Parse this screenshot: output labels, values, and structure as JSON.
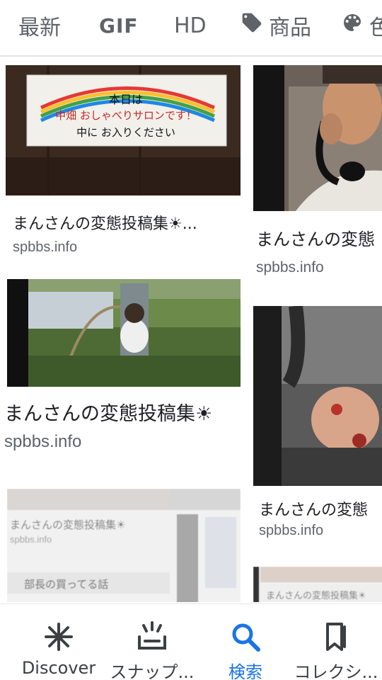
{
  "filters": [
    {
      "label": "最新"
    },
    {
      "label": "GIF"
    },
    {
      "label": "HD"
    },
    {
      "label": "商品",
      "icon": "tag-icon"
    },
    {
      "label": "色",
      "icon": "palette-icon"
    }
  ],
  "results": [
    {
      "caption": "まんさんの変態投稿集☀...",
      "domain": "spbbs.info",
      "sign_text": [
        "本日は",
        "中畑 おしゃべりサロンです！",
        "中に お入りください"
      ]
    },
    {
      "caption": "まんさんの変態",
      "domain": "spbbs.info"
    },
    {
      "caption": "まんさんの変態投稿集☀",
      "domain": "spbbs.info"
    },
    {
      "caption": "まんさんの変態",
      "domain": "spbbs.info"
    },
    {
      "caption": "まんさんの変態投稿集☀",
      "domain": "spbbs.info",
      "extra_text": "部長の買ってる話"
    },
    {
      "caption": "まんさんの変態投稿集☀"
    }
  ],
  "bottom_nav": [
    {
      "label": "Discover",
      "icon": "asterisk-icon",
      "active": false
    },
    {
      "label": "スナップ...",
      "icon": "snapshot-icon",
      "active": false
    },
    {
      "label": "検索",
      "icon": "search-icon",
      "active": true
    },
    {
      "label": "コレクシ...",
      "icon": "bookmark-icon",
      "active": false
    }
  ],
  "colors": {
    "accent": "#1a73e8",
    "text": "#202124",
    "muted": "#5f6368"
  }
}
